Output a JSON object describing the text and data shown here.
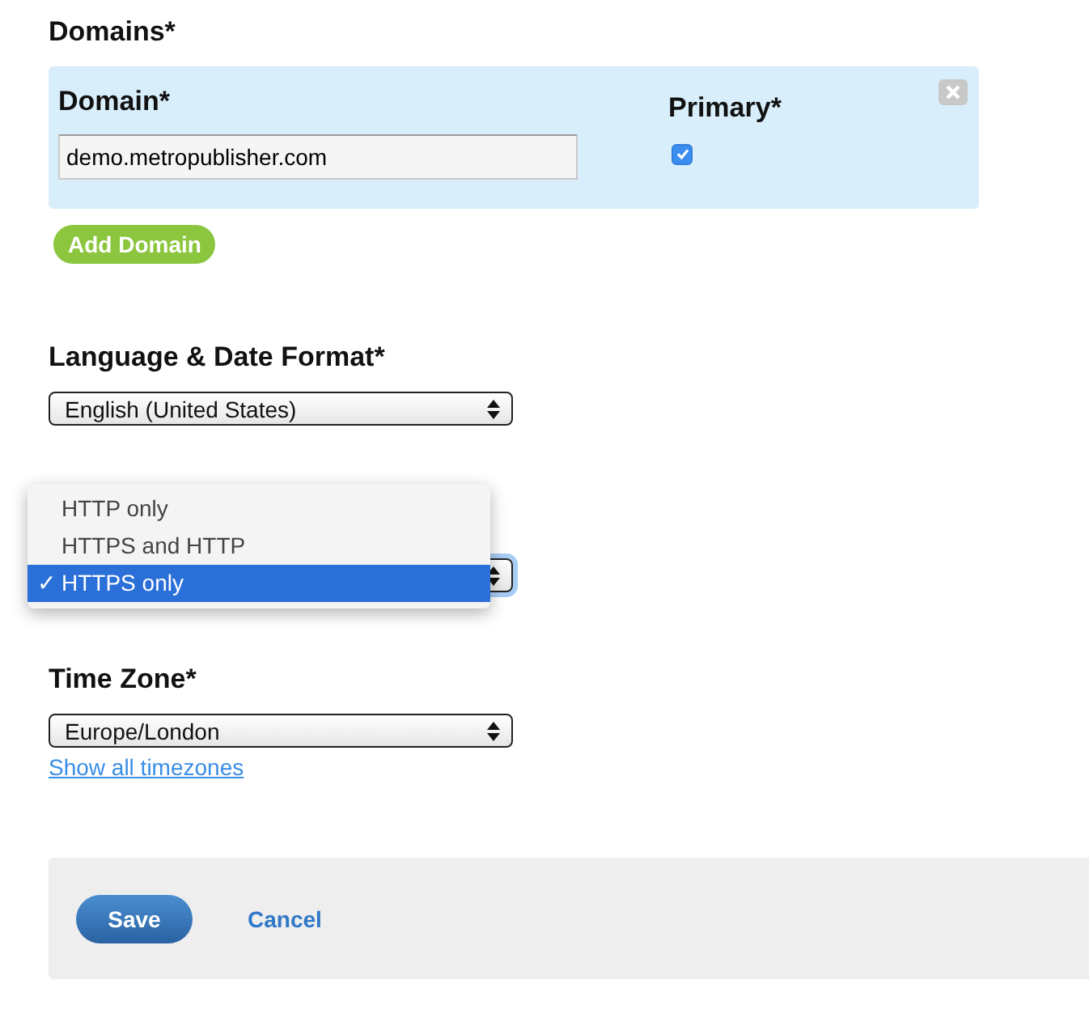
{
  "domains": {
    "heading": "Domains*",
    "items": [
      {
        "domain_label": "Domain*",
        "domain_value": "demo.metropublisher.com",
        "primary_label": "Primary*",
        "primary": true
      }
    ],
    "add_button": "Add Domain"
  },
  "language": {
    "heading": "Language & Date Format*",
    "value": "English (United States)"
  },
  "protocol": {
    "menu": [
      {
        "label": "HTTP only",
        "selected": false
      },
      {
        "label": "HTTPS and HTTP",
        "selected": false
      },
      {
        "label": "HTTPS only",
        "selected": true
      }
    ],
    "check_mark": "✓"
  },
  "timezone": {
    "heading": "Time Zone*",
    "value": "Europe/London",
    "link": "Show all timezones"
  },
  "footer": {
    "save": "Save",
    "cancel": "Cancel"
  }
}
